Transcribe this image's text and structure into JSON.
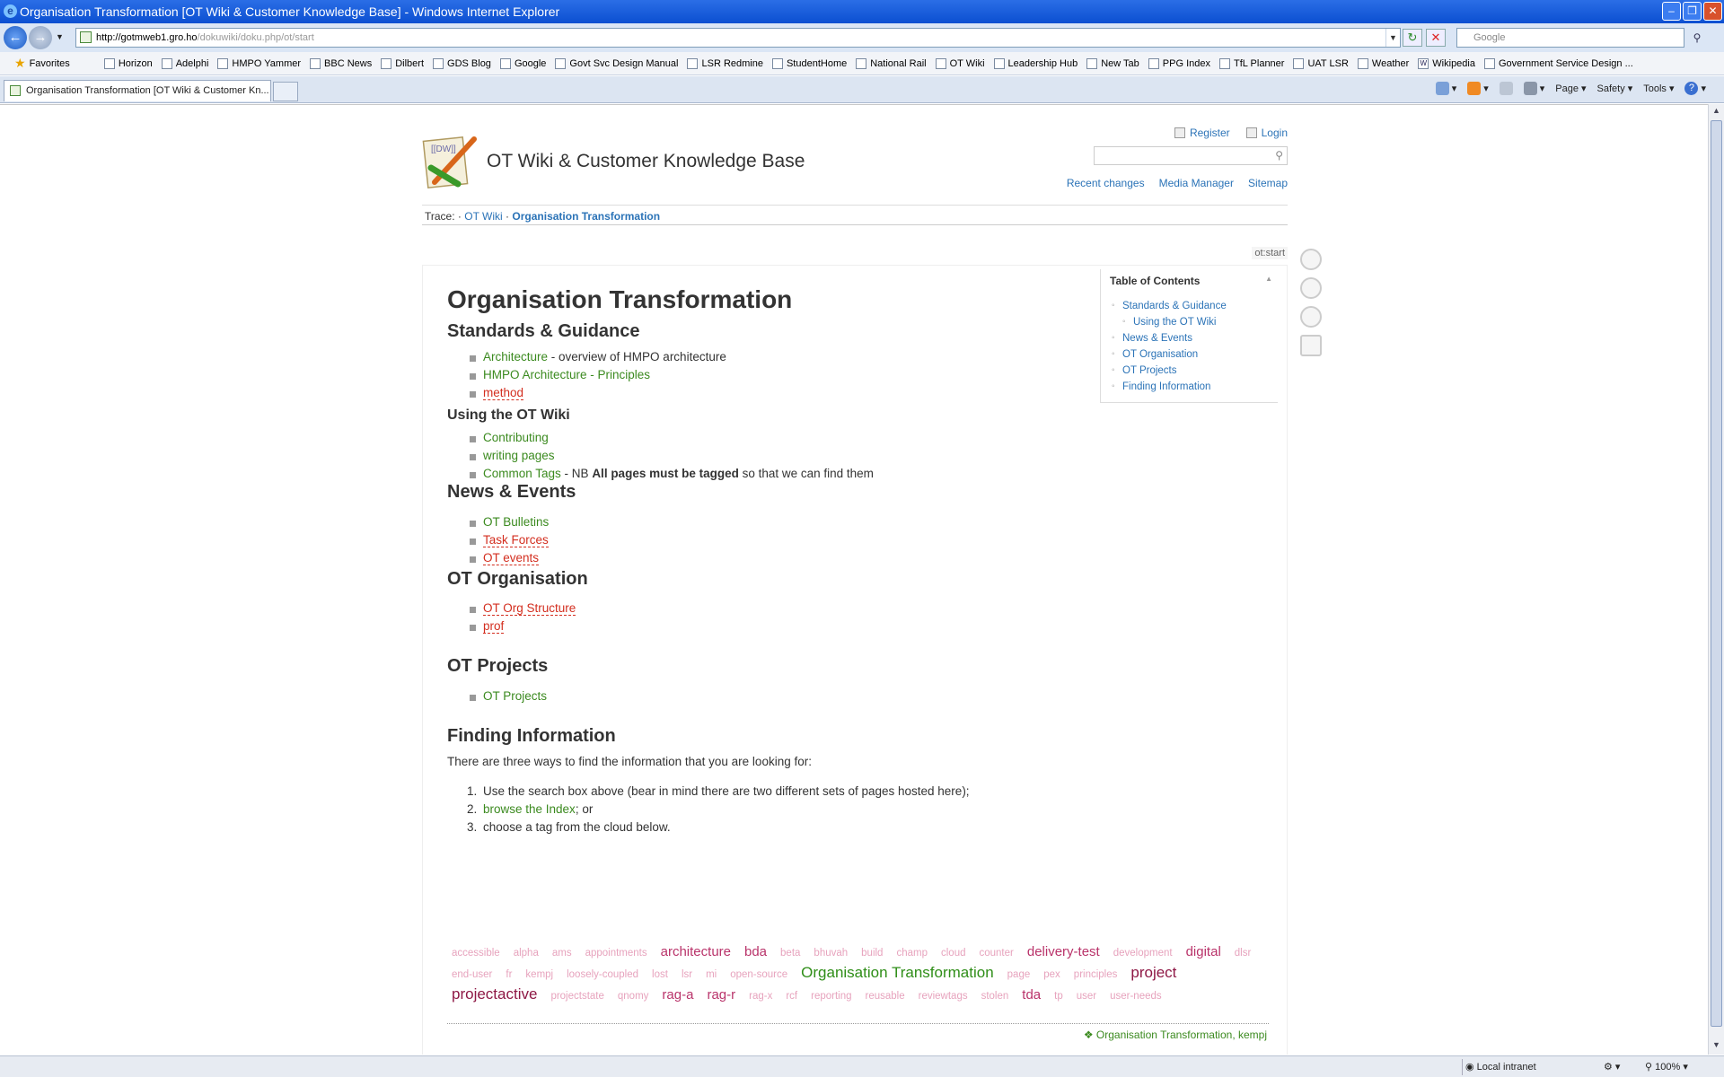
{
  "window": {
    "title": "Organisation Transformation [OT Wiki & Customer Knowledge Base] - Windows Internet Explorer",
    "icon": "ie-icon"
  },
  "address": {
    "host": "http://gotmweb1.gro.ho",
    "path": "/dokuwiki/doku.php/ot/start"
  },
  "search": {
    "placeholder": "Google"
  },
  "favorites": {
    "label": "Favorites",
    "items": [
      "Horizon",
      "Adelphi",
      "HMPO Yammer",
      "BBC News",
      "Dilbert",
      "GDS Blog",
      "Google",
      "Govt Svc Design Manual",
      "LSR Redmine",
      "StudentHome",
      "National Rail",
      "OT Wiki",
      "Leadership Hub",
      "New Tab",
      "PPG Index",
      "TfL Planner",
      "UAT LSR",
      "Weather",
      "Wikipedia",
      "Government Service Design ..."
    ]
  },
  "tab": {
    "label": "Organisation Transformation [OT Wiki & Customer Kn..."
  },
  "commands": {
    "page": "Page",
    "safety": "Safety",
    "tools": "Tools"
  },
  "status": {
    "zone": "Local intranet",
    "zoom": "100%"
  },
  "wiki": {
    "site_title": "OT Wiki & Customer Knowledge Base",
    "register": "Register",
    "login": "Login",
    "recent": "Recent changes",
    "media": "Media Manager",
    "sitemap": "Sitemap",
    "trace_label": "Trace:",
    "trace_sep1": "·",
    "trace_1": "OT Wiki",
    "trace_sep2": "·",
    "trace_2": "Organisation Transformation",
    "page_id": "ot:start",
    "toc_title": "Table of Contents",
    "toc": [
      "Standards & Guidance",
      "Using the OT Wiki",
      "News & Events",
      "OT Organisation",
      "OT Projects",
      "Finding Information"
    ],
    "h1": "Organisation Transformation",
    "s1": {
      "title": "Standards & Guidance",
      "arch": "Architecture",
      "arch_desc": " - overview of HMPO architecture",
      "principles": "HMPO Architecture - Principles",
      "method": "method"
    },
    "s2": {
      "title": "Using the OT Wiki",
      "contrib": "Contributing",
      "writing": "writing pages",
      "tags": "Common Tags",
      "nb": " - NB ",
      "bold": "All pages must be tagged",
      "rest": " so that we can find them"
    },
    "s3": {
      "title": "News & Events",
      "bulletins": "OT Bulletins",
      "taskforces": "Task Forces",
      "events": "OT events"
    },
    "s4": {
      "title": "OT Organisation",
      "orgstruct": "OT Org Structure",
      "prof": "prof"
    },
    "s5": {
      "title": "OT Projects",
      "projects": "OT Projects"
    },
    "s6": {
      "title": "Finding Information",
      "intro": "There are three ways to find the information that you are looking for:",
      "n1": "1.",
      "i1": "Use the search box above (bear in mind there are two different sets of pages hosted here);",
      "n2": "2.",
      "i2a": "browse the Index",
      "i2b": "; or",
      "n3": "3.",
      "i3": "choose a tag from the cloud below."
    },
    "tags": [
      {
        "t": "accessible",
        "w": 1
      },
      {
        "t": "alpha",
        "w": 1
      },
      {
        "t": "ams",
        "w": 1
      },
      {
        "t": "appointments",
        "w": 1
      },
      {
        "t": "architecture",
        "w": 3
      },
      {
        "t": "bda",
        "w": 3
      },
      {
        "t": "beta",
        "w": 1
      },
      {
        "t": "bhuvah",
        "w": 1
      },
      {
        "t": "build",
        "w": 1
      },
      {
        "t": "champ",
        "w": 1
      },
      {
        "t": "cloud",
        "w": 1
      },
      {
        "t": "counter",
        "w": 1
      },
      {
        "t": "delivery-test",
        "w": 3
      },
      {
        "t": "development",
        "w": 1
      },
      {
        "t": "digital",
        "w": 3
      },
      {
        "t": "dlsr",
        "w": 1
      },
      {
        "t": "end-user",
        "w": 1
      },
      {
        "t": "fr",
        "w": 1
      },
      {
        "t": "kempj",
        "w": 1
      },
      {
        "t": "loosely-coupled",
        "w": 1
      },
      {
        "t": "lost",
        "w": 1
      },
      {
        "t": "lsr",
        "w": 1
      },
      {
        "t": "mi",
        "w": 1
      },
      {
        "t": "open-source",
        "w": 1
      },
      {
        "t": "Organisation Transformation",
        "w": 5
      },
      {
        "t": "page",
        "w": 1
      },
      {
        "t": "pex",
        "w": 1
      },
      {
        "t": "principles",
        "w": 1
      },
      {
        "t": "project",
        "w": 4
      },
      {
        "t": "projectactive",
        "w": 4
      },
      {
        "t": "projectstate",
        "w": 1
      },
      {
        "t": "qnomy",
        "w": 1
      },
      {
        "t": "rag-a",
        "w": 2
      },
      {
        "t": "rag-r",
        "w": 2
      },
      {
        "t": "rag-x",
        "w": 1
      },
      {
        "t": "rcf",
        "w": 1
      },
      {
        "t": "reporting",
        "w": 1
      },
      {
        "t": "reusable",
        "w": 1
      },
      {
        "t": "reviewtags",
        "w": 1
      },
      {
        "t": "stolen",
        "w": 1
      },
      {
        "t": "tda",
        "w": 2
      },
      {
        "t": "tp",
        "w": 1
      },
      {
        "t": "user",
        "w": 1
      },
      {
        "t": "user-needs",
        "w": 1
      }
    ],
    "page_tags": "Organisation Transformation, kempj"
  }
}
